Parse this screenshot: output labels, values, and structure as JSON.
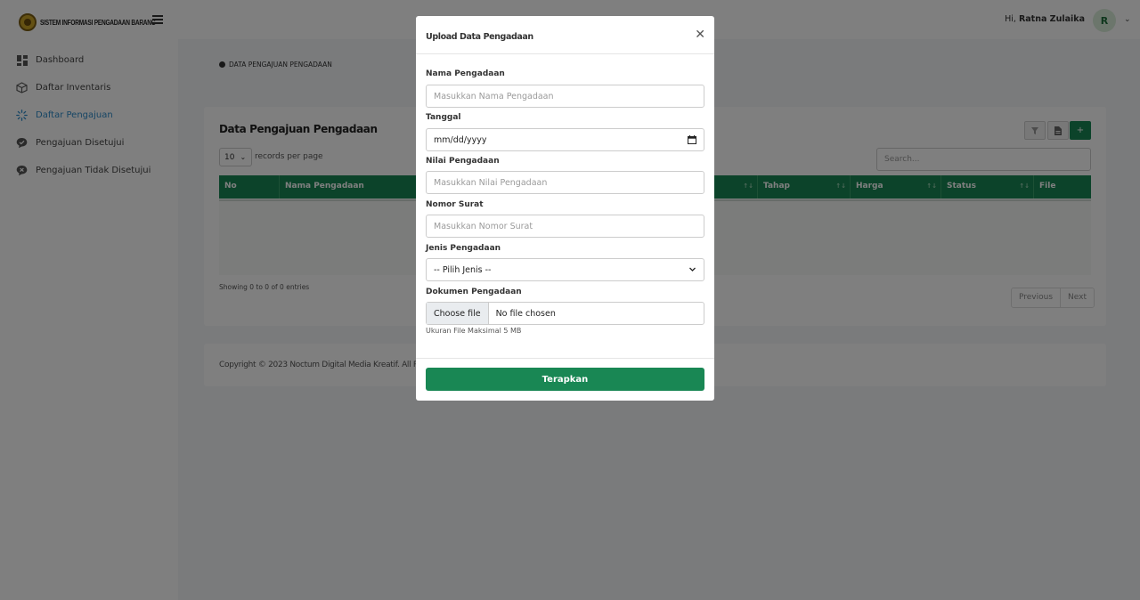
{
  "brand": {
    "title": "SISTEM INFORMASI PENGADAAN BARANG"
  },
  "sidebar": {
    "items": [
      {
        "label": "Dashboard",
        "icon": "dashboard-grid-icon",
        "active": false
      },
      {
        "label": "Daftar Inventaris",
        "icon": "box-icon",
        "active": false
      },
      {
        "label": "Daftar Pengajuan",
        "icon": "spinner-icon",
        "active": true
      },
      {
        "label": "Pengajuan Disetujui",
        "icon": "check-chat-icon",
        "active": false
      },
      {
        "label": "Pengajuan Tidak Disetujui",
        "icon": "x-chat-icon",
        "active": false
      }
    ]
  },
  "header": {
    "greeting_prefix": "Hi,",
    "user_name": "Ratna Zulaika",
    "avatar_initial": "R"
  },
  "breadcrumb": {
    "text": "DATA PENGAJUAN PENGADAAN"
  },
  "table_card": {
    "title": "Data Pengajuan Pengadaan",
    "tools": {
      "filter_icon": "filter-icon",
      "export_icon": "file-icon",
      "add_label": "+"
    },
    "per_page_value": "10",
    "per_page_label": "records per page",
    "search_placeholder": "Search...",
    "columns": [
      "No",
      "Nama Pengadaan",
      "Tahap",
      "Harga",
      "Status",
      "File"
    ],
    "showing": "Showing 0 to 0 of 0 entries",
    "pager": {
      "previous": "Previous",
      "next": "Next"
    }
  },
  "footer": {
    "copyright": "Copyright © 2023 Noctum Digital Media Kreatif. All Righ"
  },
  "modal": {
    "title": "Upload Data Pengadaan",
    "fields": {
      "nama_label": "Nama Pengadaan",
      "nama_placeholder": "Masukkan Nama Pengadaan",
      "tanggal_label": "Tanggal",
      "tanggal_value": "mm/dd/yyyy",
      "nilai_label": "Nilai Pengadaan",
      "nilai_placeholder": "Masukkan Nilai Pengadaan",
      "nomor_label": "Nomor Surat",
      "nomor_placeholder": "Masukkan Nomor Surat",
      "jenis_label": "Jenis Pengadaan",
      "jenis_value": "-- Pilih Jenis --",
      "dokumen_label": "Dokumen Pengadaan",
      "file_button": "Choose file",
      "file_status": "No file chosen",
      "hint": "Ukuran File Maksimal 5 MB"
    },
    "submit_label": "Terapkan"
  }
}
